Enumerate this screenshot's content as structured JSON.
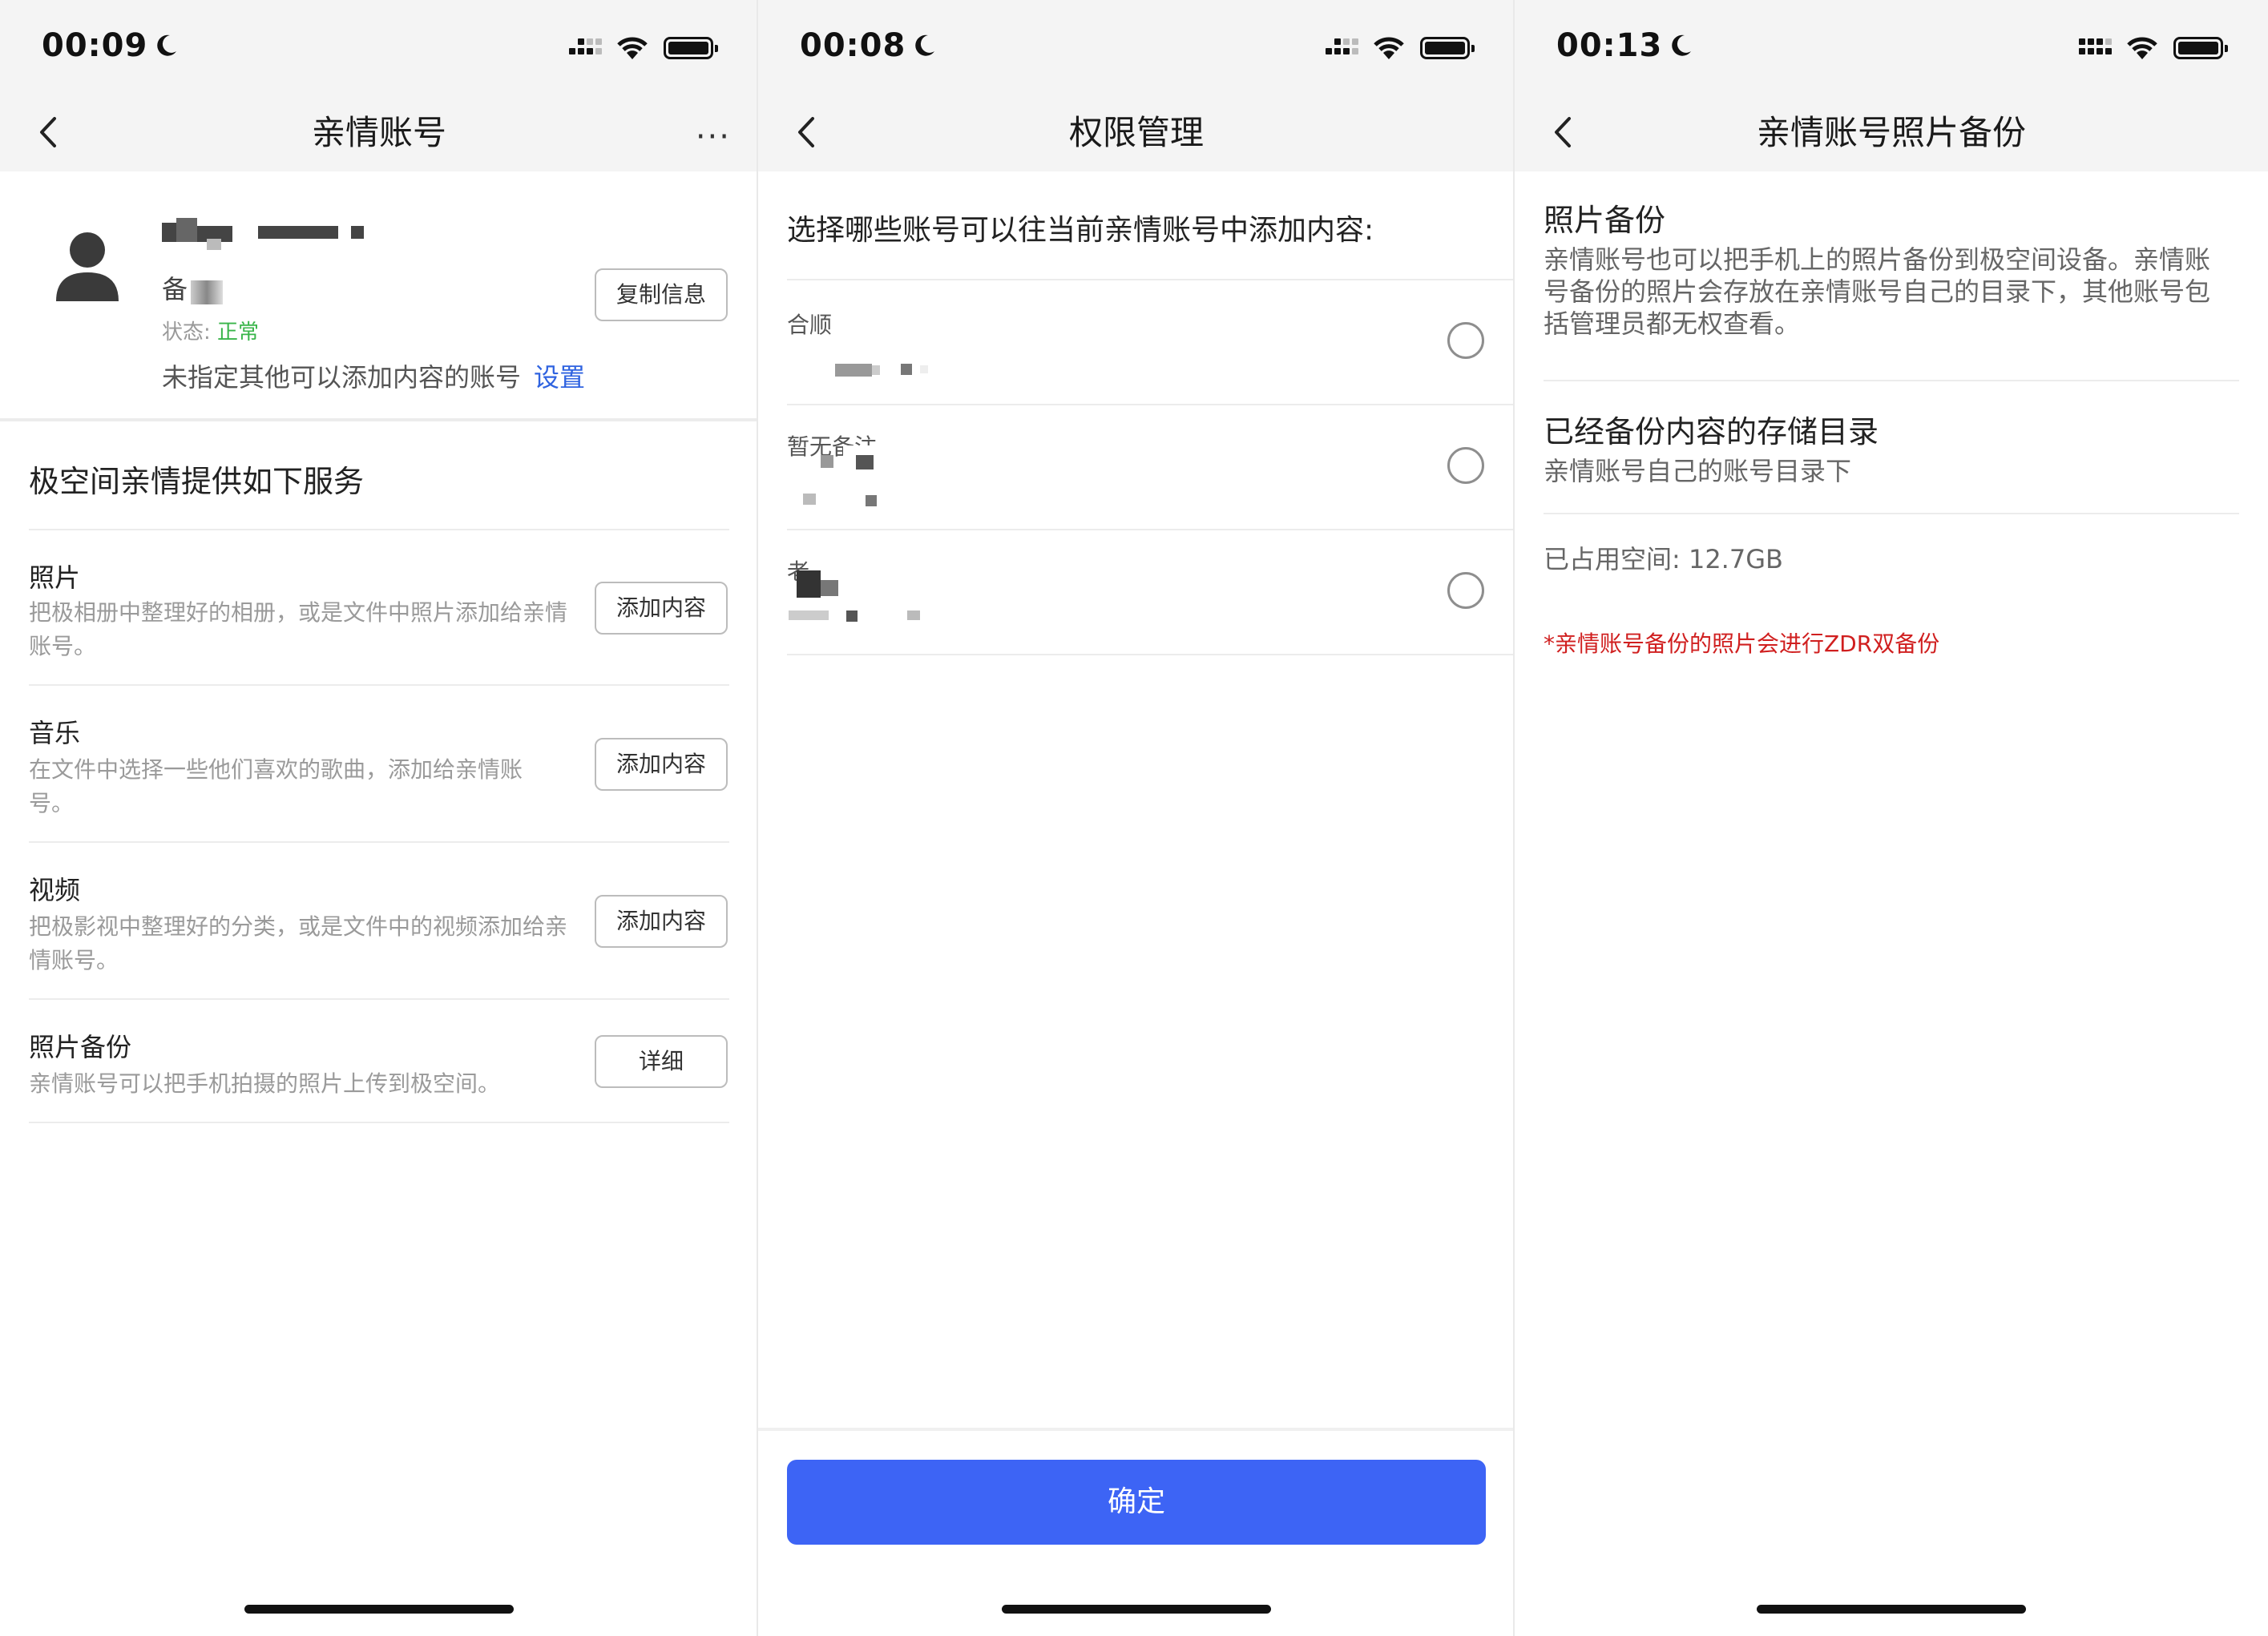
{
  "colors": {
    "accent": "#3d64f5",
    "link": "#2f63e0",
    "status_ok": "#39b54a",
    "warning": "#d01f1f",
    "nav_bg": "#f4f4f4"
  },
  "screen1": {
    "status_time": "00:09",
    "nav_title": "亲情账号",
    "more_icon": "more-dots-icon",
    "account": {
      "note_label": "备",
      "status_label": "状态:",
      "status_value": "正常",
      "copy_button": "复制信息",
      "hint": "未指定其他可以添加内容的账号",
      "hint_link": "设置"
    },
    "services_title": "极空间亲情提供如下服务",
    "services": [
      {
        "title": "照片",
        "desc": "把极相册中整理好的相册，或是文件中照片添加给亲情账号。",
        "button": "添加内容"
      },
      {
        "title": "音乐",
        "desc": "在文件中选择一些他们喜欢的歌曲，添加给亲情账号。",
        "button": "添加内容"
      },
      {
        "title": "视频",
        "desc": "把极影视中整理好的分类，或是文件中的视频添加给亲情账号。",
        "button": "添加内容"
      },
      {
        "title": "照片备份",
        "desc": "亲情账号可以把手机拍摄的照片上传到极空间。",
        "button": "详细"
      }
    ]
  },
  "screen2": {
    "status_time": "00:08",
    "nav_title": "权限管理",
    "prompt": "选择哪些账号可以往当前亲情账号中添加内容:",
    "accounts": [
      {
        "label": "合顺"
      },
      {
        "label": "暂无备注"
      },
      {
        "label": "老"
      }
    ],
    "confirm_button": "确定"
  },
  "screen3": {
    "status_time": "00:13",
    "nav_title": "亲情账号照片备份",
    "backup_title": "照片备份",
    "backup_desc": "亲情账号也可以把手机上的照片备份到极空间设备。亲情账号备份的照片会存放在亲情账号自己的目录下，其他账号包括管理员都无权查看。",
    "dir_title": "已经备份内容的存储目录",
    "dir_desc": "亲情账号自己的账号目录下",
    "space_used": "已占用空间: 12.7GB",
    "note": "*亲情账号备份的照片会进行ZDR双备份"
  }
}
